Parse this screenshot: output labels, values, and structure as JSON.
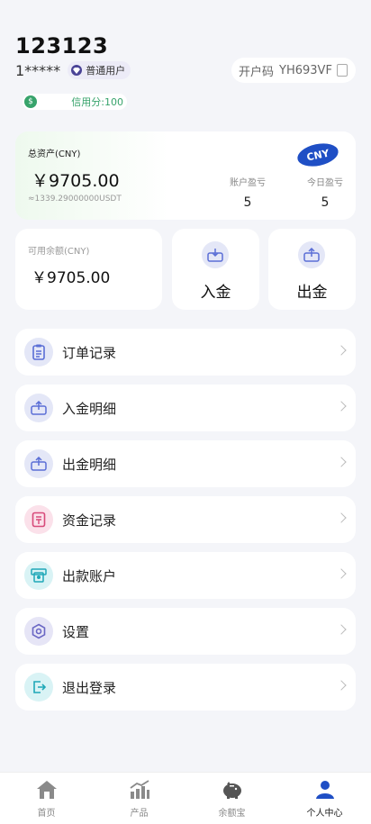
{
  "profile": {
    "username": "123123",
    "account_masked": "1*****",
    "level": "普通用户",
    "invite_label": "开户码",
    "invite_code": "YH693VF",
    "credit": "信用分:100"
  },
  "assets": {
    "label": "总资产(CNY)",
    "amount": "￥9705.00",
    "usdt": "≈1339.29000000USDT",
    "currency_badge": "CNY",
    "account_pl_label": "账户盈亏",
    "account_pl_value": "5",
    "today_pl_label": "今日盈亏",
    "today_pl_value": "5"
  },
  "available": {
    "label": "可用余额(CNY)",
    "amount": "￥9705.00"
  },
  "actions": {
    "deposit": "入金",
    "withdraw": "出金"
  },
  "menu": [
    {
      "label": "订单记录",
      "icon": "clipboard-icon",
      "color": "#5b6fd6"
    },
    {
      "label": "入金明细",
      "icon": "deposit-box-icon",
      "color": "#5b6fd6"
    },
    {
      "label": "出金明细",
      "icon": "withdraw-box-icon",
      "color": "#5b6fd6"
    },
    {
      "label": "资金记录",
      "icon": "fund-record-icon",
      "color": "#d84a7a"
    },
    {
      "label": "出款账户",
      "icon": "atm-card-icon",
      "color": "#1fa8b8"
    },
    {
      "label": "设置",
      "icon": "settings-hex-icon",
      "color": "#6a66c4"
    },
    {
      "label": "退出登录",
      "icon": "logout-icon",
      "color": "#1fa8b8"
    }
  ],
  "tabs": [
    {
      "label": "首页",
      "icon": "home-icon"
    },
    {
      "label": "产品",
      "icon": "chart-icon"
    },
    {
      "label": "余额宝",
      "icon": "piggy-bank-icon"
    },
    {
      "label": "个人中心",
      "icon": "user-icon",
      "active": true
    }
  ]
}
